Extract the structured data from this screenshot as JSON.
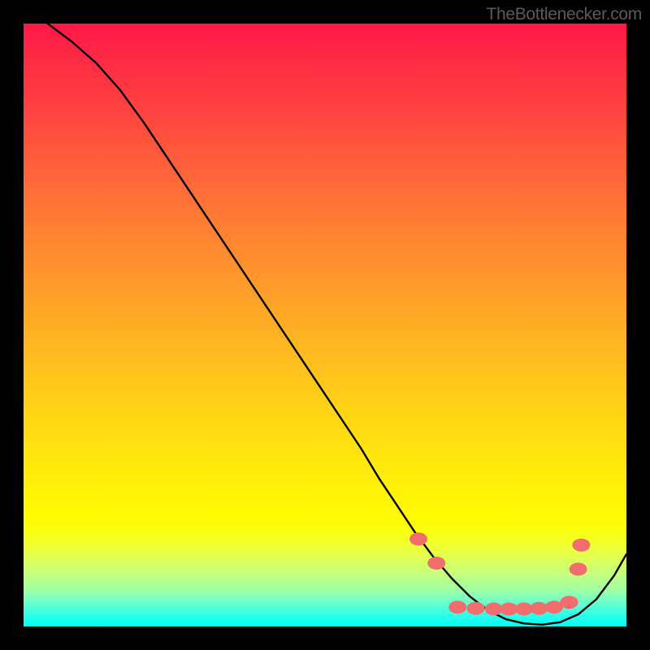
{
  "watermark": "TheBottlenecker.com",
  "chart_data": {
    "type": "line",
    "title": "",
    "xlabel": "",
    "ylabel": "",
    "xlim": [
      0,
      100
    ],
    "ylim": [
      0,
      100
    ],
    "series": [
      {
        "name": "curve",
        "x": [
          4,
          8,
          12,
          16,
          20,
          24,
          28,
          32,
          36,
          40,
          44,
          48,
          52,
          56,
          59,
          62,
          65,
          68,
          71,
          74,
          77,
          80,
          83,
          86,
          89,
          92,
          95,
          98,
          100
        ],
        "values": [
          100,
          97,
          93.5,
          89,
          83.5,
          77.5,
          71.5,
          65.5,
          59.5,
          53.5,
          47.5,
          41.5,
          35.5,
          29.5,
          24.5,
          20,
          15.5,
          11.5,
          8,
          5,
          2.7,
          1.2,
          0.5,
          0.3,
          0.7,
          2.0,
          4.5,
          8.5,
          12
        ]
      }
    ],
    "markers": [
      {
        "x": 65.5,
        "y": 14.5
      },
      {
        "x": 68.5,
        "y": 10.5
      },
      {
        "x": 72,
        "y": 3.2
      },
      {
        "x": 75,
        "y": 3.0
      },
      {
        "x": 78,
        "y": 2.9
      },
      {
        "x": 80.5,
        "y": 2.9
      },
      {
        "x": 83,
        "y": 2.9
      },
      {
        "x": 85.5,
        "y": 3.0
      },
      {
        "x": 88,
        "y": 3.2
      },
      {
        "x": 90.5,
        "y": 4.0
      },
      {
        "x": 92,
        "y": 9.5
      },
      {
        "x": 92.5,
        "y": 13.5
      }
    ],
    "marker_color": "#f26d6d"
  }
}
